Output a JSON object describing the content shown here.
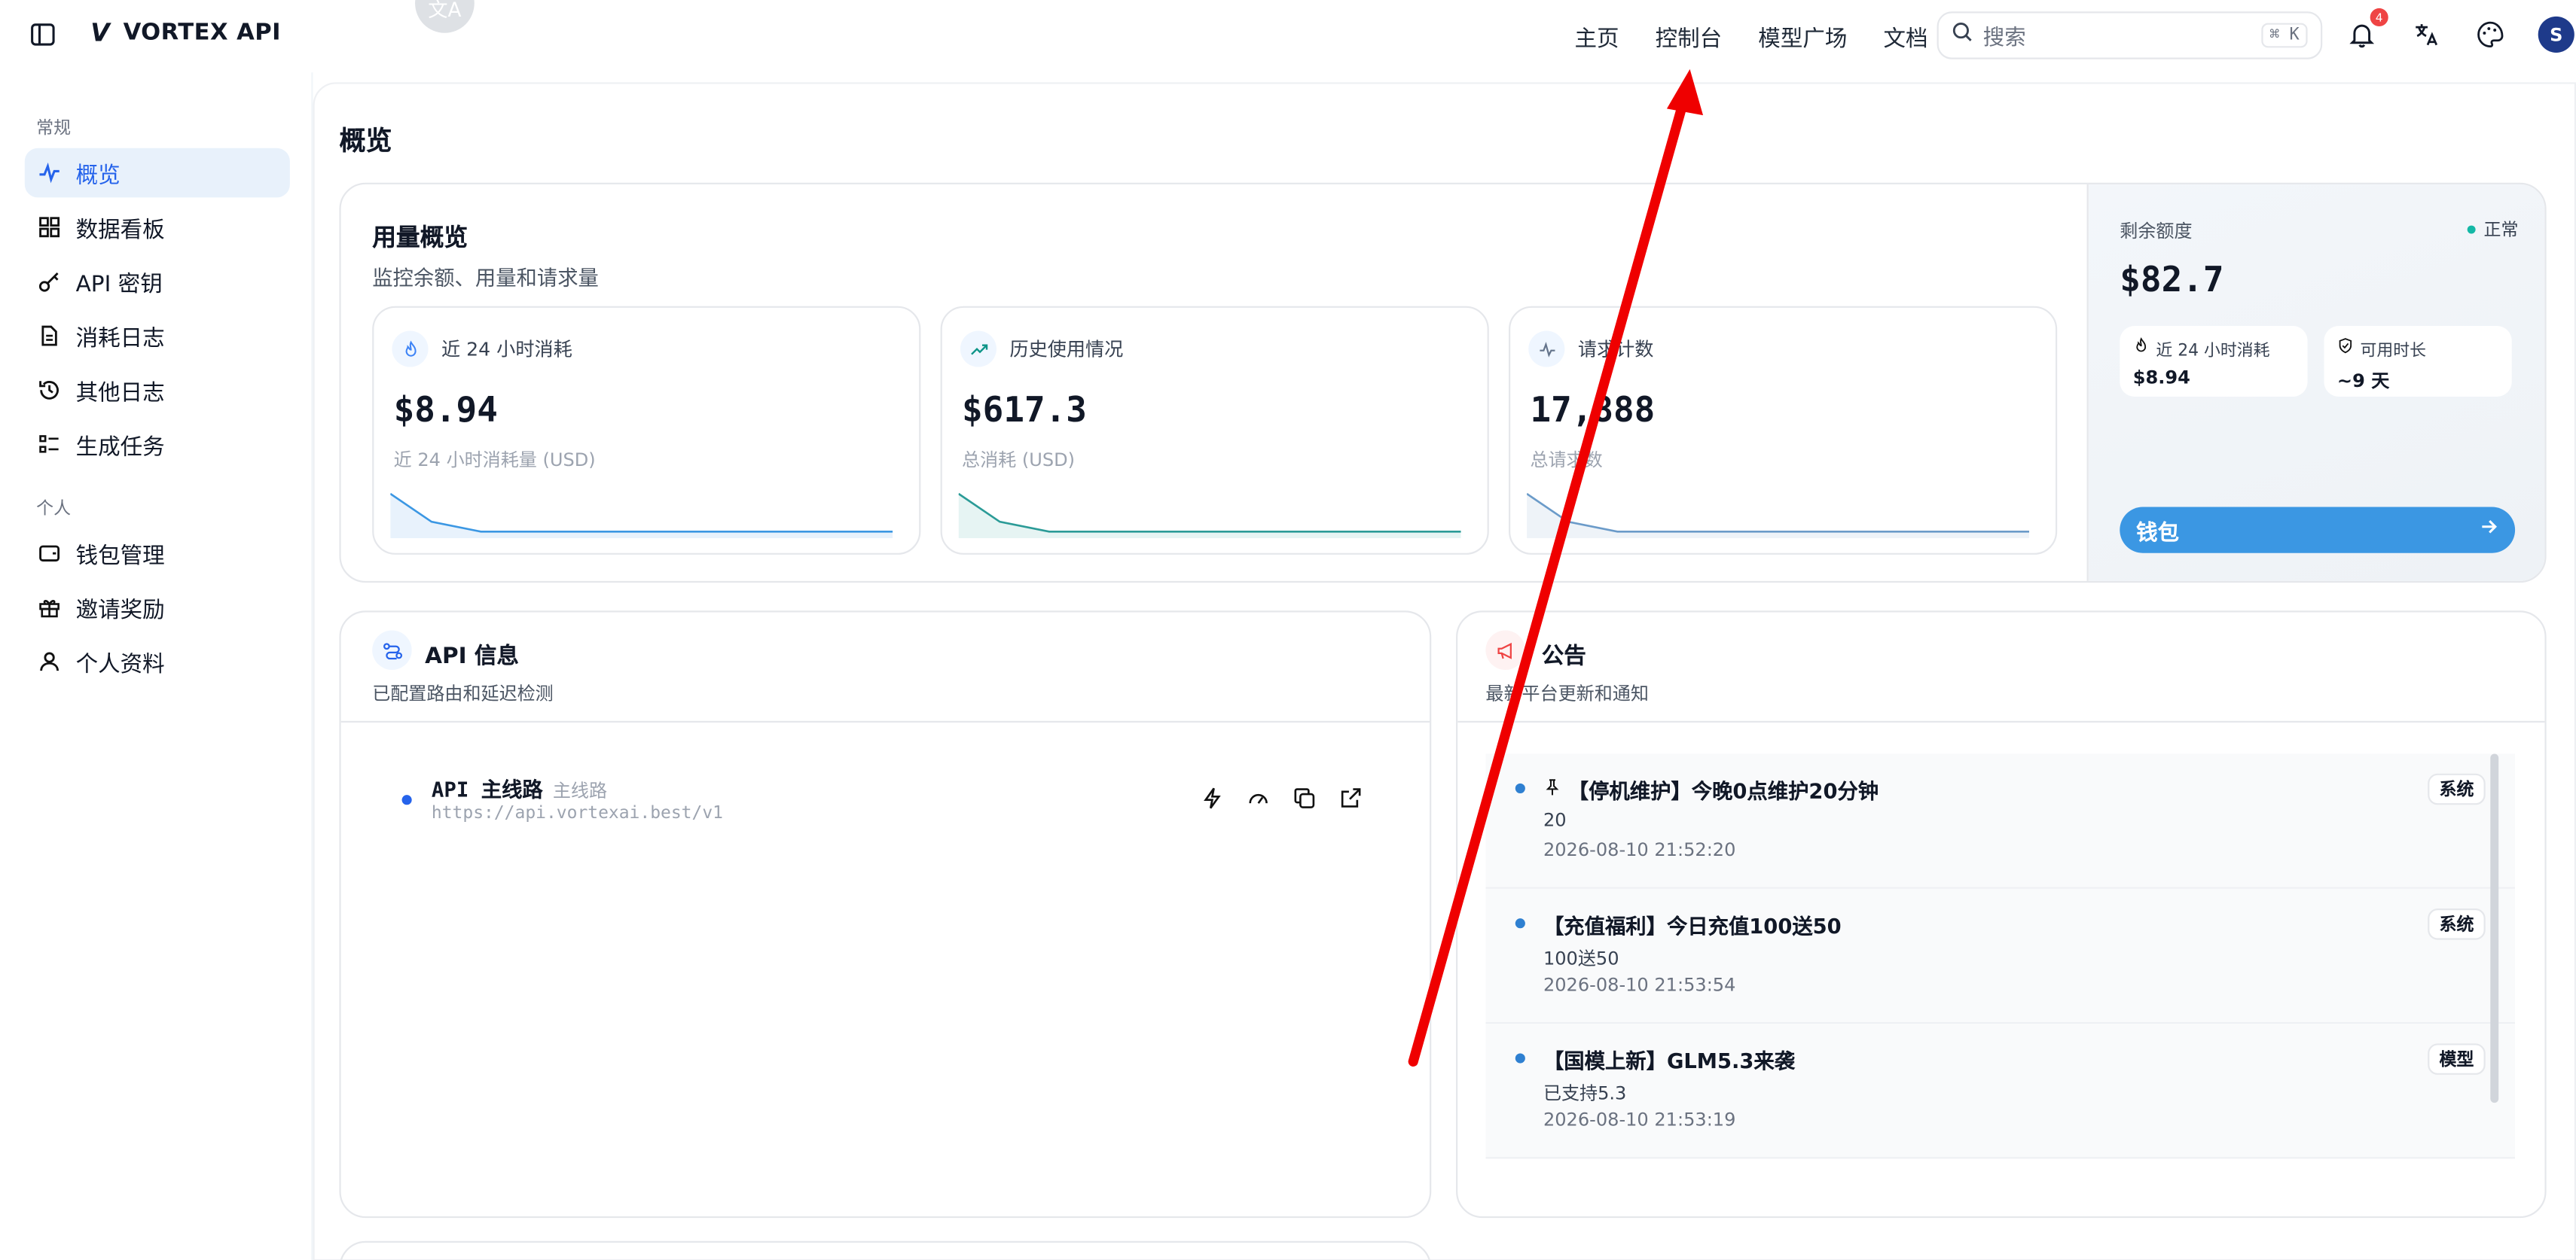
{
  "header": {
    "brand": "VORTEX API",
    "brand_logo": "V",
    "translate_badge": "文A",
    "nav": [
      "主页",
      "控制台",
      "模型广场",
      "文档"
    ],
    "search_placeholder": "搜索",
    "search_kbd": "⌘ K",
    "notif_count": "4",
    "avatar_initial": "S"
  },
  "sidebar": {
    "section_general": "常规",
    "section_personal": "个人",
    "items": [
      {
        "label": "概览",
        "icon": "activity-icon",
        "active": true
      },
      {
        "label": "数据看板",
        "icon": "dashboard-icon"
      },
      {
        "label": "API 密钥",
        "icon": "key-icon"
      },
      {
        "label": "消耗日志",
        "icon": "document-icon"
      },
      {
        "label": "其他日志",
        "icon": "history-icon"
      },
      {
        "label": "生成任务",
        "icon": "task-list-icon"
      },
      {
        "label": "钱包管理",
        "icon": "wallet-icon"
      },
      {
        "label": "邀请奖励",
        "icon": "gift-icon"
      },
      {
        "label": "个人资料",
        "icon": "user-icon"
      }
    ]
  },
  "page_title": "概览",
  "usage": {
    "title": "用量概览",
    "subtitle": "监控余额、用量和请求量",
    "stats": [
      {
        "label": "近 24 小时消耗",
        "value": "$8.94",
        "sub": "近 24 小时消耗量 (USD)",
        "icon": "flame-icon"
      },
      {
        "label": "历史使用情况",
        "value": "$617.3",
        "sub": "总消耗 (USD)",
        "icon": "trend-up-icon"
      },
      {
        "label": "请求计数",
        "value": "17,888",
        "sub": "总请求数",
        "icon": "pulse-icon"
      }
    ]
  },
  "balance": {
    "label": "剩余额度",
    "status": "正常",
    "value": "$82.7",
    "mini": [
      {
        "label": "近 24 小时消耗",
        "value": "$8.94",
        "icon": "flame-icon"
      },
      {
        "label": "可用时长",
        "value": "~9 天",
        "icon": "shield-icon"
      }
    ],
    "wallet_button": "钱包"
  },
  "api_info": {
    "title": "API 信息",
    "subtitle": "已配置路由和延迟检测",
    "route_name": "API 主线路",
    "route_tag": "主线路",
    "route_url": "https://api.vortexai.best/v1"
  },
  "announcements": {
    "title": "公告",
    "subtitle": "最新平台更新和通知",
    "items": [
      {
        "title": "【停机维护】今晚0点维护20分钟",
        "body": "20",
        "date": "2026-08-10 21:52:20",
        "tag": "系统",
        "pinned": true
      },
      {
        "title": "【充值福利】今日充值100送50",
        "body": "100送50",
        "date": "2026-08-10 21:53:54",
        "tag": "系统",
        "pinned": false
      },
      {
        "title": "【国模上新】GLM5.3来袭",
        "body": "已支持5.3",
        "date": "2026-08-10 21:53:19",
        "tag": "模型",
        "pinned": false
      }
    ]
  },
  "colors": {
    "accent": "#3b97e3",
    "active_bg": "#e8f1fb",
    "annotation_arrow": "#ef0000"
  }
}
